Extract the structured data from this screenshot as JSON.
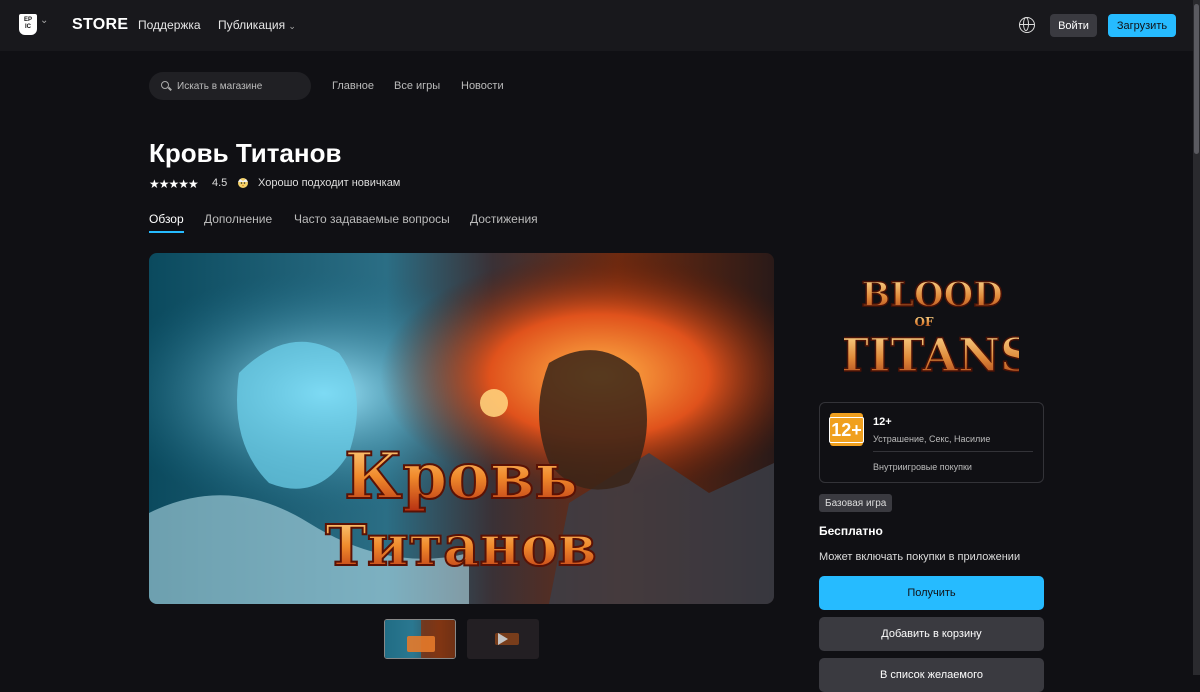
{
  "header": {
    "logo_text": "EPIC GAMES",
    "store_label": "STORE",
    "nav": [
      "Поддержка",
      "Публикация"
    ],
    "login_label": "Войти",
    "download_label": "Загрузить"
  },
  "search": {
    "placeholder": "Искать в магазине"
  },
  "subnav": [
    "Главное",
    "Все игры",
    "Новости"
  ],
  "game": {
    "title": "Кровь Титанов",
    "stars": "★★★★★",
    "rating": "4.5",
    "badge": "Хорошо подходит новичкам",
    "hero_title_line1": "Кровь",
    "hero_title_line2": "Титанов",
    "logo_line1": "BLOOD",
    "logo_line2": "OF",
    "logo_line3": "TITANS"
  },
  "tabs": [
    "Обзор",
    "Дополнение",
    "Часто задаваемые вопросы",
    "Достижения"
  ],
  "rating_card": {
    "age": "12+",
    "age_label": "12+",
    "descriptors": "Устрашение, Секс, Насилие",
    "iap": "Внутриигровые покупки"
  },
  "purchase": {
    "base_game": "Базовая игра",
    "price": "Бесплатно",
    "note": "Может включать покупки в приложении",
    "get_label": "Получить",
    "cart_label": "Добавить в корзину",
    "wishlist_label": "В список желаемого"
  },
  "colors": {
    "accent": "#26bbff",
    "background": "#101014",
    "header": "#18181c",
    "age_badge": "#f0a01e"
  }
}
